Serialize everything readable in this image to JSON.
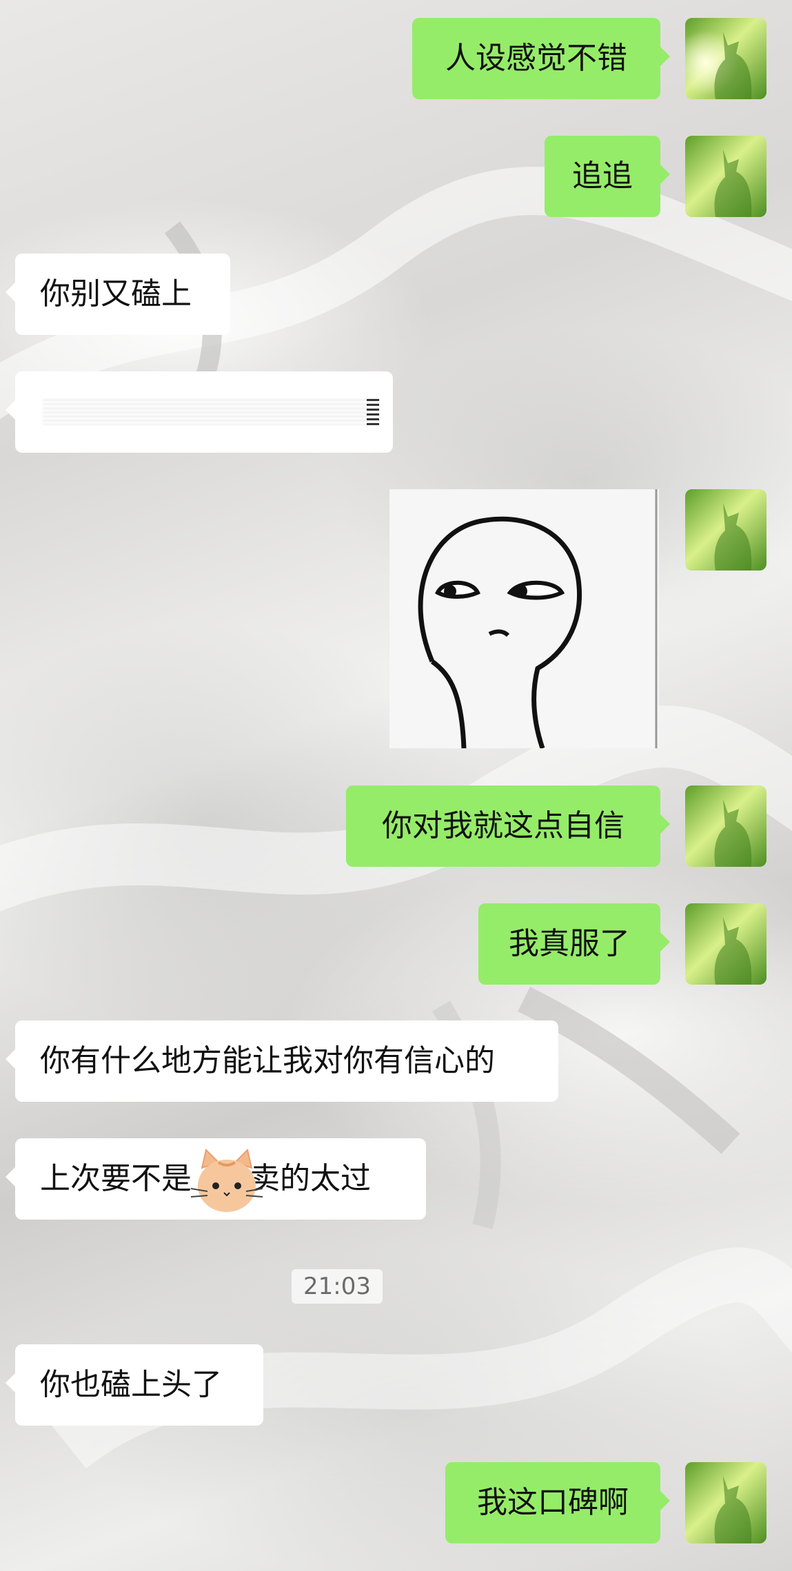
{
  "timestamp": "21:03",
  "messages": [
    {
      "side": "out",
      "text": "人设感觉不错"
    },
    {
      "side": "out",
      "text": "追追"
    },
    {
      "side": "in",
      "text": "你别又磕上"
    },
    {
      "side": "in",
      "text": ""
    },
    {
      "side": "out",
      "text": ""
    },
    {
      "side": "out",
      "text": "你对我就这点自信"
    },
    {
      "side": "out",
      "text": "我真服了"
    },
    {
      "side": "in",
      "text": "你有什么地方能让我对你有信心的"
    },
    {
      "side": "in",
      "text_before": "上次要不是",
      "text_after": "卖的太过"
    },
    {
      "side": "in",
      "text": "你也磕上头了"
    },
    {
      "side": "out",
      "text": "我这口碑啊"
    }
  ],
  "icons": {
    "avatar": "cat-avatar-icon",
    "inline_emoji": "cat-face-emoji-icon"
  },
  "colors": {
    "outgoing_bubble": "#95ec69",
    "incoming_bubble": "#ffffff",
    "timestamp_text": "#6b6b6b"
  }
}
